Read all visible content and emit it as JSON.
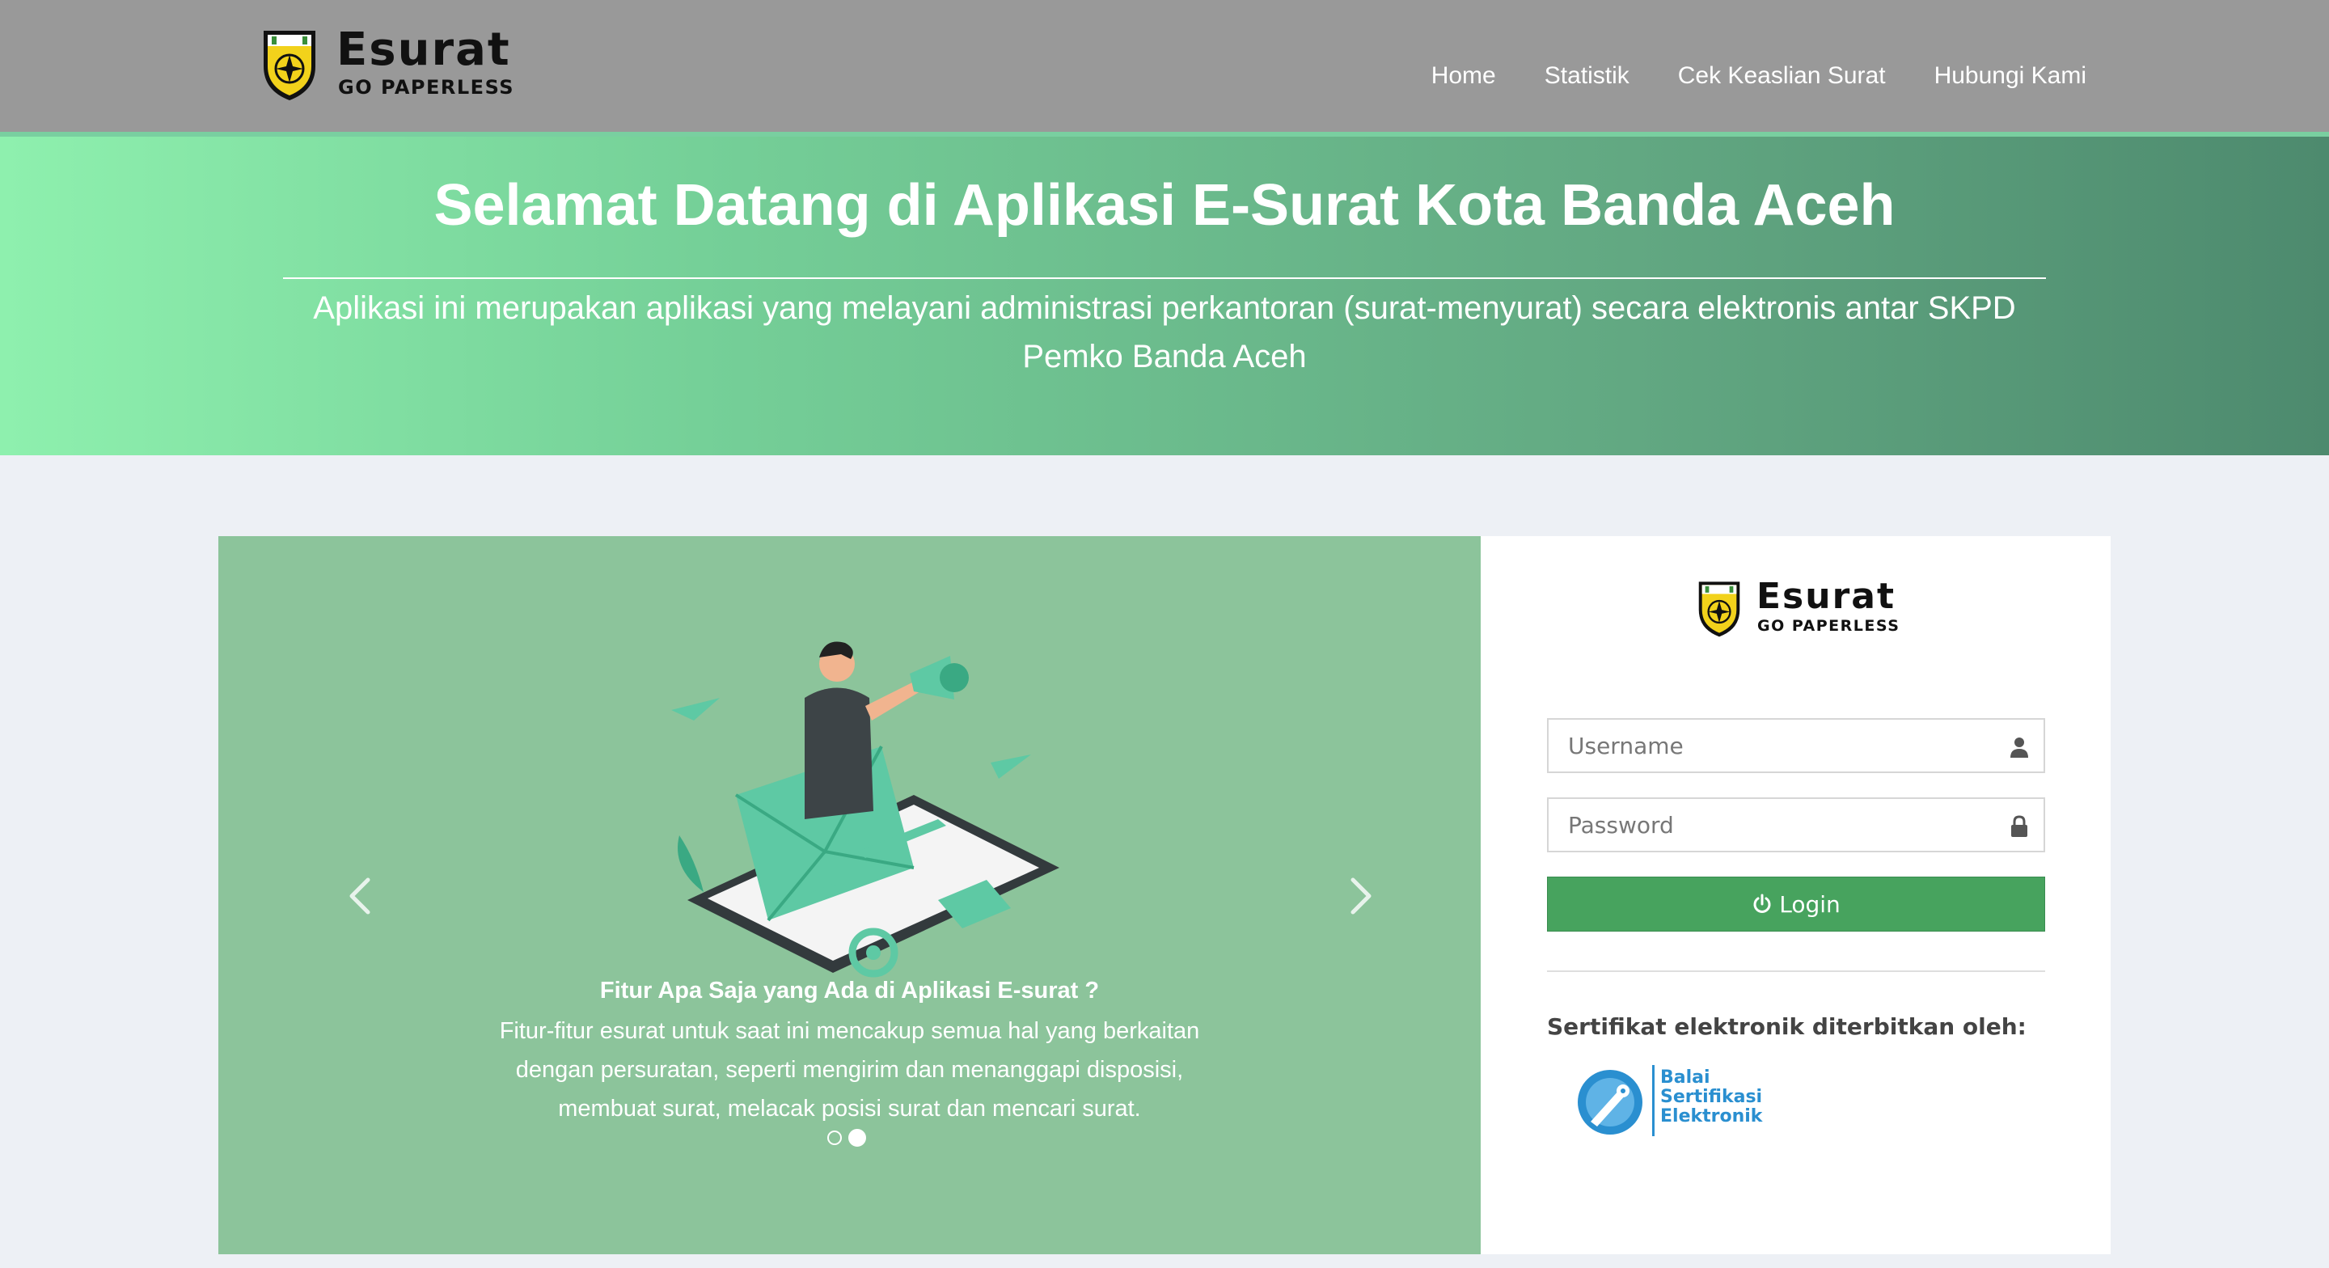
{
  "brand": {
    "wordmark": "Esurat",
    "tagline": "GO PAPERLESS"
  },
  "nav": {
    "items": [
      {
        "label": "Home"
      },
      {
        "label": "Statistik"
      },
      {
        "label": "Cek Keaslian Surat"
      },
      {
        "label": "Hubungi Kami"
      }
    ]
  },
  "hero": {
    "title": "Selamat Datang di Aplikasi E-Surat Kota Banda Aceh",
    "subtitle": "Aplikasi ini merupakan aplikasi yang melayani administrasi perkantoran (surat-menyurat) secara elektronis antar SKPD Pemko Banda Aceh"
  },
  "carousel": {
    "caption_title": "Fitur Apa Saja yang Ada di Aplikasi E-surat ?",
    "caption_text": "Fitur-fitur esurat untuk saat ini mencakup semua hal yang berkaitan dengan persuratan, seperti mengirim dan menanggapi disposisi, membuat surat, melacak posisi surat dan mencari surat.",
    "slide_count": 2,
    "active_slide": 2,
    "prev_icon": "chevron-left-icon",
    "next_icon": "chevron-right-icon"
  },
  "login": {
    "username_placeholder": "Username",
    "username_value": "",
    "password_placeholder": "Password",
    "password_value": "",
    "button_label": "Login",
    "user_icon": "user-icon",
    "lock_icon": "lock-icon",
    "power_icon": "power-icon",
    "cert_label": "Sertifikat elektronik diterbitkan oleh:"
  },
  "certifier": {
    "line1": "Balai",
    "line2": "Sertifikasi",
    "line3": "Elektronik"
  },
  "colors": {
    "navbar": "#999999",
    "hero_start": "#8ef0ae",
    "hero_end": "#4d8a6e",
    "carousel_bg": "#8cc49b",
    "login_button": "#47a35e",
    "page_bg": "#edf0f5",
    "certifier_blue": "#2a8fd0"
  }
}
